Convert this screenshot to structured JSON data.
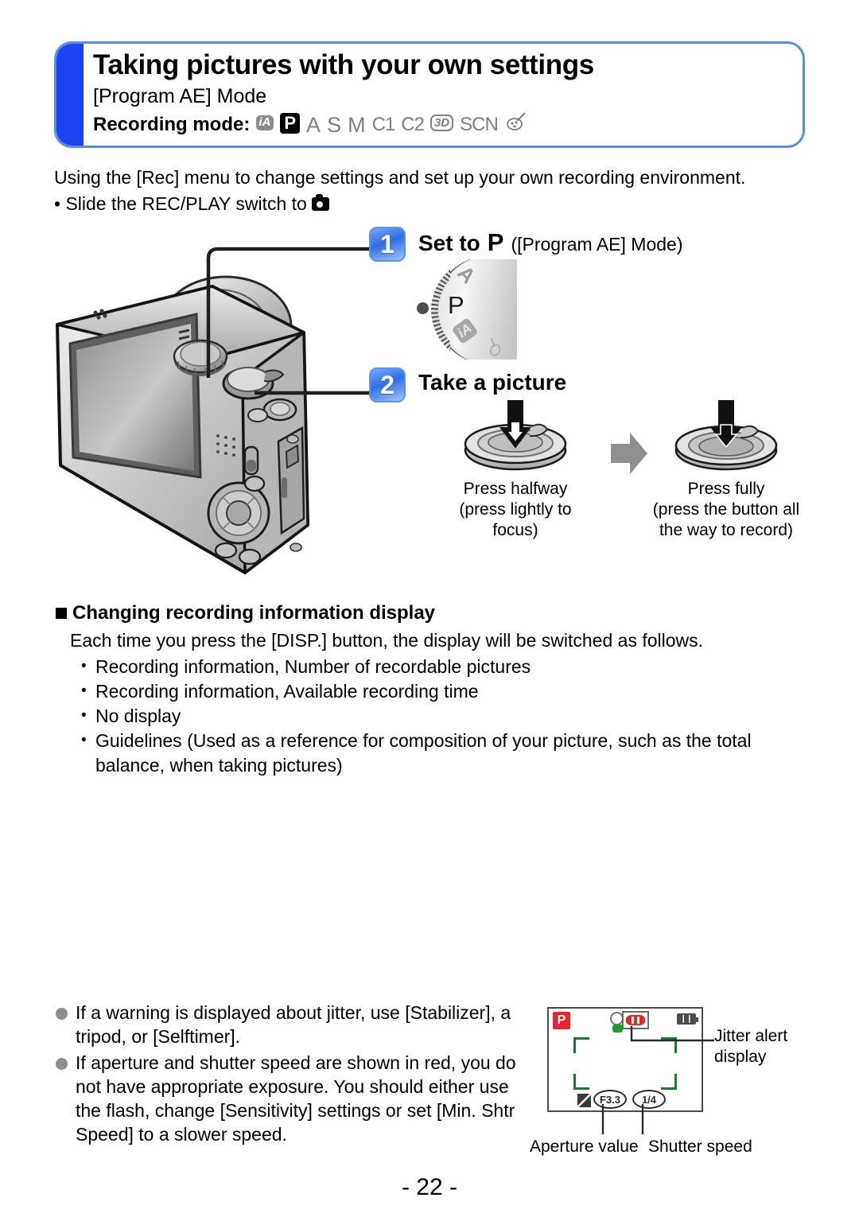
{
  "header": {
    "title": "Taking pictures with your own settings",
    "subtitle": "[Program AE] Mode",
    "recording_mode_label": "Recording mode:",
    "modes": [
      {
        "id": "ia",
        "label": "iA",
        "state": "inactive"
      },
      {
        "id": "p",
        "label": "P",
        "state": "active"
      },
      {
        "id": "a",
        "label": "A",
        "state": "inactive"
      },
      {
        "id": "s",
        "label": "S",
        "state": "inactive"
      },
      {
        "id": "m",
        "label": "M",
        "state": "inactive"
      },
      {
        "id": "c1",
        "label": "C1",
        "state": "inactive"
      },
      {
        "id": "c2",
        "label": "C2",
        "state": "inactive"
      },
      {
        "id": "3d",
        "label": "3D",
        "state": "inactive"
      },
      {
        "id": "scn",
        "label": "SCN",
        "state": "inactive"
      },
      {
        "id": "creative",
        "label": "Creative Control",
        "state": "inactive"
      }
    ],
    "accent_bar_color": "#1a44f0",
    "border_color": "#5a8cf5"
  },
  "intro": {
    "line1": "Using the [Rec] menu to change settings and set up your own recording environment.",
    "bullet_prefix": "• Slide the REC/PLAY switch to"
  },
  "steps": [
    {
      "number": "1",
      "heading": "Set to",
      "mode_mark": "P",
      "heading_suffix": "([Program AE] Mode)",
      "dial": {
        "labels": [
          "A",
          "P",
          "iA",
          "Creative"
        ],
        "selected": "P"
      }
    },
    {
      "number": "2",
      "heading": "Take a picture",
      "press": [
        {
          "title": "Press halfway",
          "detail": "(press lightly to focus)",
          "arrow": "hollow-down-arrow"
        },
        {
          "title": "Press fully",
          "detail": "(press the button all the way to record)",
          "arrow": "solid-down-arrow"
        }
      ]
    }
  ],
  "section": {
    "heading": "Changing recording information display",
    "intro": "Each time you press the [DISP.] button, the display will be switched as follows.",
    "items": [
      "Recording information, Number of recordable pictures",
      "Recording information, Available recording time",
      "No display",
      "Guidelines (Used as a reference for composition of your picture, such as the total balance, when taking pictures)"
    ]
  },
  "notes": [
    "If a warning is displayed about jitter, use [Stabilizer], a tripod, or [Selftimer].",
    "If aperture and shutter speed are shown in red, you do not have appropriate exposure. You should either use the flash, change [Sensitivity] settings or set [Min. Shtr Speed] to a slower speed."
  ],
  "lcd_figure": {
    "mode_badge": "P",
    "mode_badge_color": "#e8242c",
    "aperture_value": "F3.3",
    "shutter_speed": "1/4",
    "labels": {
      "jitter": "Jitter alert display",
      "jitter_line1": "Jitter alert",
      "jitter_line2": "display",
      "aperture": "Aperture value",
      "shutter": "Shutter speed"
    },
    "af_frame_color": "#1a7a2e",
    "jitter_icon_color": "#e02a22"
  },
  "footer": {
    "page_number": "- 22 -"
  }
}
